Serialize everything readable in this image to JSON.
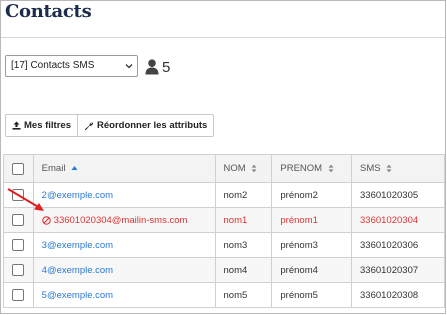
{
  "page": {
    "title": "Contacts"
  },
  "filter": {
    "selected": "[17] Contacts SMS"
  },
  "contacts_count": "5",
  "toolbar": {
    "filters_label": "Mes filtres",
    "reorder_label": "Réordonner les attributs"
  },
  "table": {
    "headers": {
      "email": "Email",
      "nom": "NOM",
      "prenom": "PRENOM",
      "sms": "SMS"
    },
    "rows": [
      {
        "email": "2@exemple.com",
        "nom": "nom2",
        "prenom": "prénom2",
        "sms": "33601020305"
      },
      {
        "email": "33601020304@mailin-sms.com",
        "nom": "nom1",
        "prenom": "prénom1",
        "sms": "33601020304"
      },
      {
        "email": "3@exemple.com",
        "nom": "nom3",
        "prenom": "prénom3",
        "sms": "33601020306"
      },
      {
        "email": "4@exemple.com",
        "nom": "nom4",
        "prenom": "prénom4",
        "sms": "33601020307"
      },
      {
        "email": "5@exemple.com",
        "nom": "nom5",
        "prenom": "prénom5",
        "sms": "33601020308"
      }
    ]
  },
  "colors": {
    "link": "#2a7ad5",
    "error": "#d33333",
    "title": "#1c2c4c",
    "annotation_arrow": "#e02020"
  },
  "icons": {
    "count": "user-icon",
    "filters": "upload-icon",
    "reorder": "wrench-icon",
    "sort_email": "sort-asc-icon",
    "sort_other": "sort-icon",
    "error_row": "blocked-icon"
  }
}
